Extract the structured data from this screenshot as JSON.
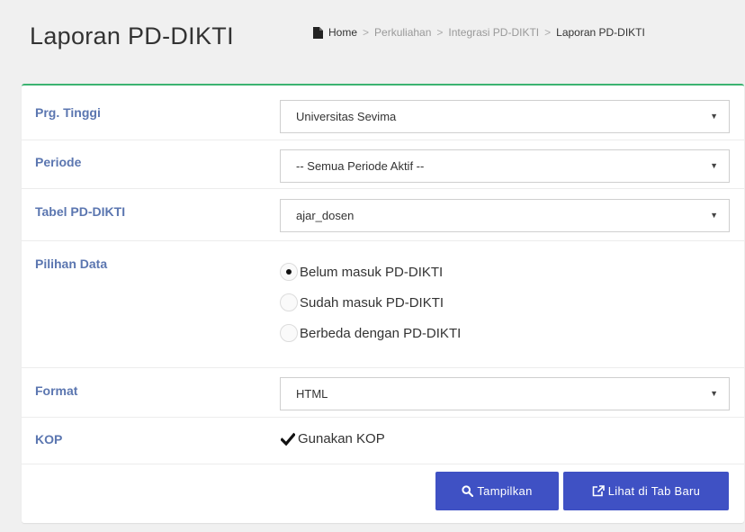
{
  "header": {
    "title": "Laporan PD-DIKTI",
    "breadcrumb": [
      "Home",
      "Perkuliahan",
      "Integrasi PD-DIKTI",
      "Laporan PD-DIKTI"
    ],
    "separator": ">"
  },
  "form": {
    "perguruan_tinggi": {
      "label": "Prg. Tinggi",
      "value": "Universitas Sevima"
    },
    "periode": {
      "label": "Periode",
      "value": "-- Semua Periode Aktif --"
    },
    "tabel": {
      "label": "Tabel PD-DIKTI",
      "value": "ajar_dosen"
    },
    "pilihan_data": {
      "label": "Pilihan Data",
      "options": [
        "Belum masuk PD-DIKTI",
        "Sudah masuk PD-DIKTI",
        "Berbeda dengan PD-DIKTI"
      ],
      "selected": "Belum masuk PD-DIKTI"
    },
    "format": {
      "label": "Format",
      "value": "HTML"
    },
    "kop": {
      "label": "KOP",
      "checkbox_label": "Gunakan KOP",
      "checked": true
    }
  },
  "buttons": {
    "tampilkan": "Tampilkan",
    "lihat_tab_baru": "Lihat di Tab Baru"
  },
  "colors": {
    "accent": "#3f51c4",
    "label": "#5b76b0",
    "box_border": "#3cb371"
  }
}
